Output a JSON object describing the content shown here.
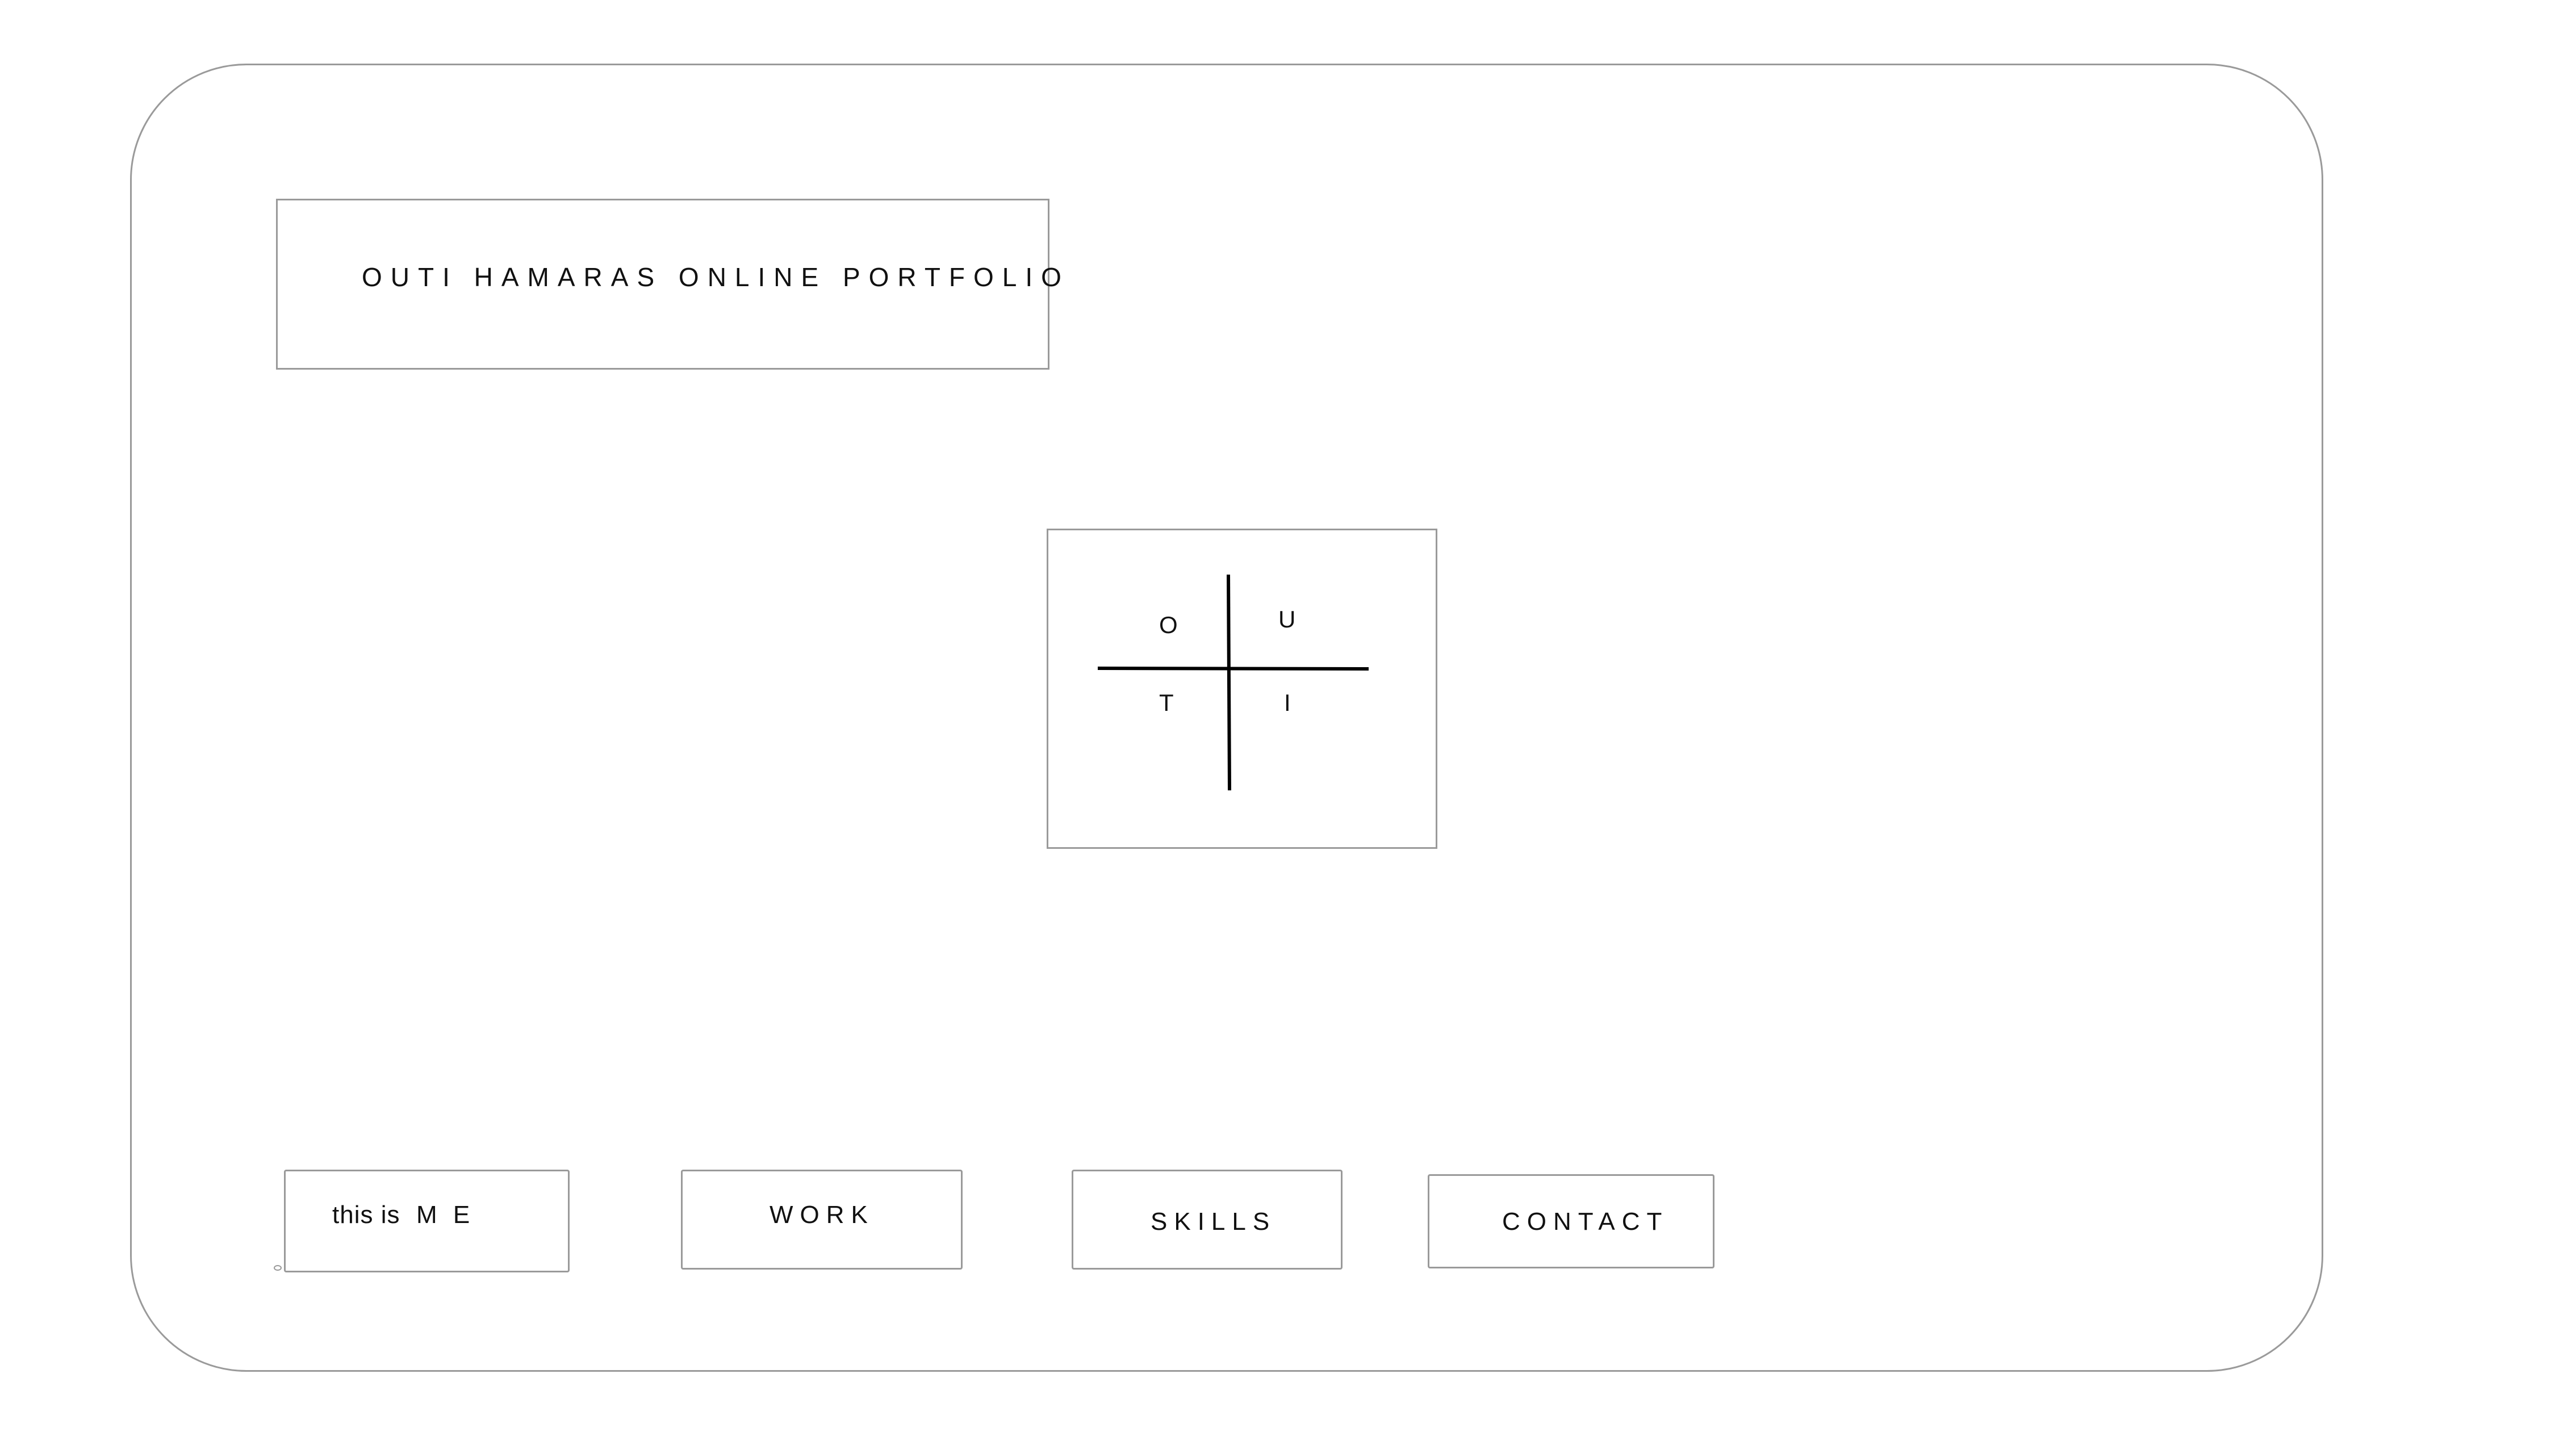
{
  "header": {
    "title": "OUTI  HAMARAS ONLINE PORTFOLIO"
  },
  "logo": {
    "letters": [
      "O",
      "U",
      "T",
      "I"
    ]
  },
  "nav": {
    "me_prefix": "this is",
    "me_label": "M E",
    "work_label": "WORK",
    "skills_label": "SKILLS",
    "contact_label": "CONTACT"
  },
  "colors": {
    "border": "#9a9a9a",
    "text": "#111111",
    "background": "#ffffff"
  }
}
